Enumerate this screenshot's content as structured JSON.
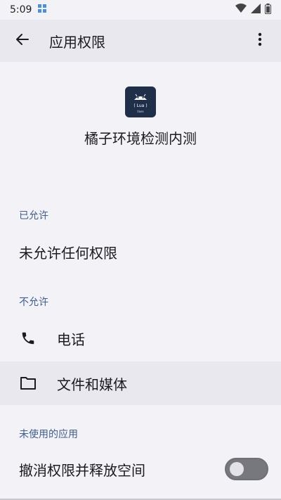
{
  "status_bar": {
    "time": "5:09",
    "icons": [
      "notification-icon",
      "wifi-icon",
      "signal-icon",
      "battery-icon"
    ]
  },
  "app_bar": {
    "title": "应用权限",
    "back_icon": "arrow-left-icon",
    "more_icon": "more-vert-icon"
  },
  "app": {
    "name": "橘子环境检测内测",
    "icon_text": "( Lua )",
    "icon_subtext": "llaes"
  },
  "sections": {
    "allowed": {
      "label": "已允许",
      "empty_text": "未允许任何权限"
    },
    "not_allowed": {
      "label": "不允许",
      "items": [
        {
          "icon": "phone-icon",
          "label": "电话"
        },
        {
          "icon": "folder-icon",
          "label": "文件和媒体"
        }
      ]
    },
    "unused_apps": {
      "label": "未使用的应用",
      "toggle_label": "撤消权限并释放空间",
      "toggle_on": false
    }
  },
  "colors": {
    "background": "#f3f2f7",
    "app_bar": "#e9e8ee",
    "section_label": "#3f5f90",
    "app_icon_bg": "#1f2f4a"
  }
}
